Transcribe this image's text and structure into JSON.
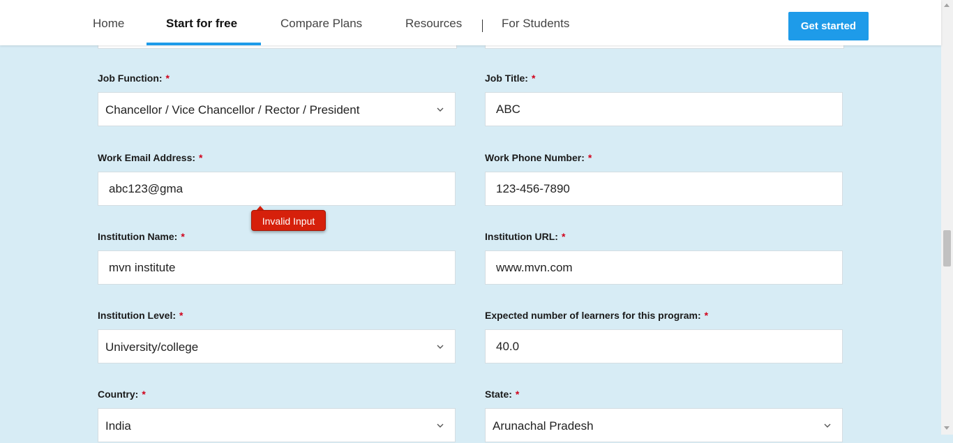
{
  "nav": {
    "items": [
      "Home",
      "Start for free",
      "Compare Plans",
      "Resources",
      "For Students"
    ],
    "active_index": 1,
    "cta_label": "Get started",
    "accent_color": "#1e9be9"
  },
  "form": {
    "required_marker": "*",
    "fields": {
      "job_function": {
        "label": "Job Function:",
        "value": "Chancellor / Vice Chancellor / Rector / President",
        "type": "select"
      },
      "job_title": {
        "label": "Job Title:",
        "value": "ABC",
        "type": "text"
      },
      "work_email": {
        "label": "Work Email Address:",
        "value": "abc123@gma",
        "type": "text"
      },
      "work_phone": {
        "label": "Work Phone Number:",
        "value": "123-456-7890",
        "type": "text"
      },
      "institution_name": {
        "label": "Institution Name:",
        "value": "mvn institute",
        "type": "text"
      },
      "institution_url": {
        "label": "Institution URL:",
        "value": "www.mvn.com",
        "type": "text"
      },
      "institution_level": {
        "label": "Institution Level:",
        "value": "University/college",
        "type": "select"
      },
      "expected_learners": {
        "label": "Expected number of learners for this program:",
        "value": "40.0",
        "type": "text"
      },
      "country": {
        "label": "Country:",
        "value": "India",
        "type": "select"
      },
      "state": {
        "label": "State:",
        "value": "Arunachal Pradesh",
        "type": "select"
      }
    },
    "validation_message": "Invalid Input",
    "error_color": "#d6200b",
    "required_color": "#d0021b"
  }
}
